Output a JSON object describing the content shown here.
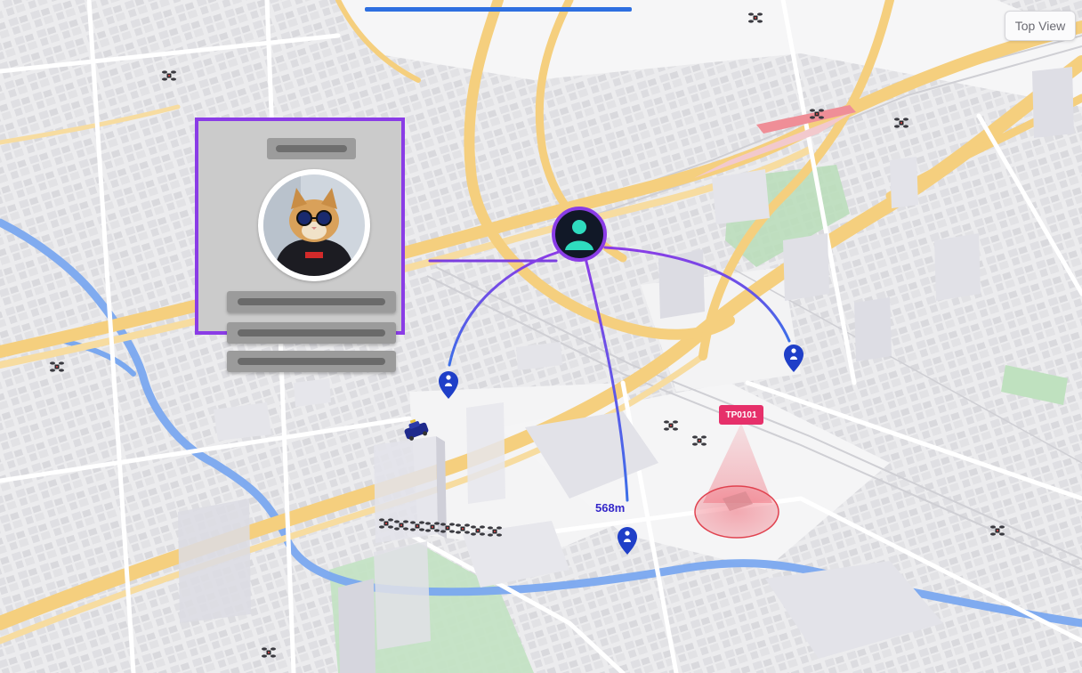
{
  "map": {
    "view_button_label": "Top View",
    "distance_label": "568m",
    "camera_tag": "TP0101",
    "user_marker_icon": "person-icon",
    "location_pin_icon": "person-pin-icon",
    "drone_icon": "drone-icon",
    "vehicle_icon": "police-car-icon"
  },
  "colors": {
    "card_border": "#8a3ce6",
    "link_line": "#7b3fe0",
    "arc_start": "#3b6fe8",
    "arc_end": "#8a3ce6",
    "user_marker_ring": "#8a3ce6",
    "user_marker_fill": "#2fdcbf",
    "pin": "#1f3fc8",
    "camera_badge": "#e6306a",
    "camera_zone": "#f06a78",
    "road": "#f5cf7e",
    "river": "#7aa8ef",
    "park": "#b8ddb8"
  }
}
